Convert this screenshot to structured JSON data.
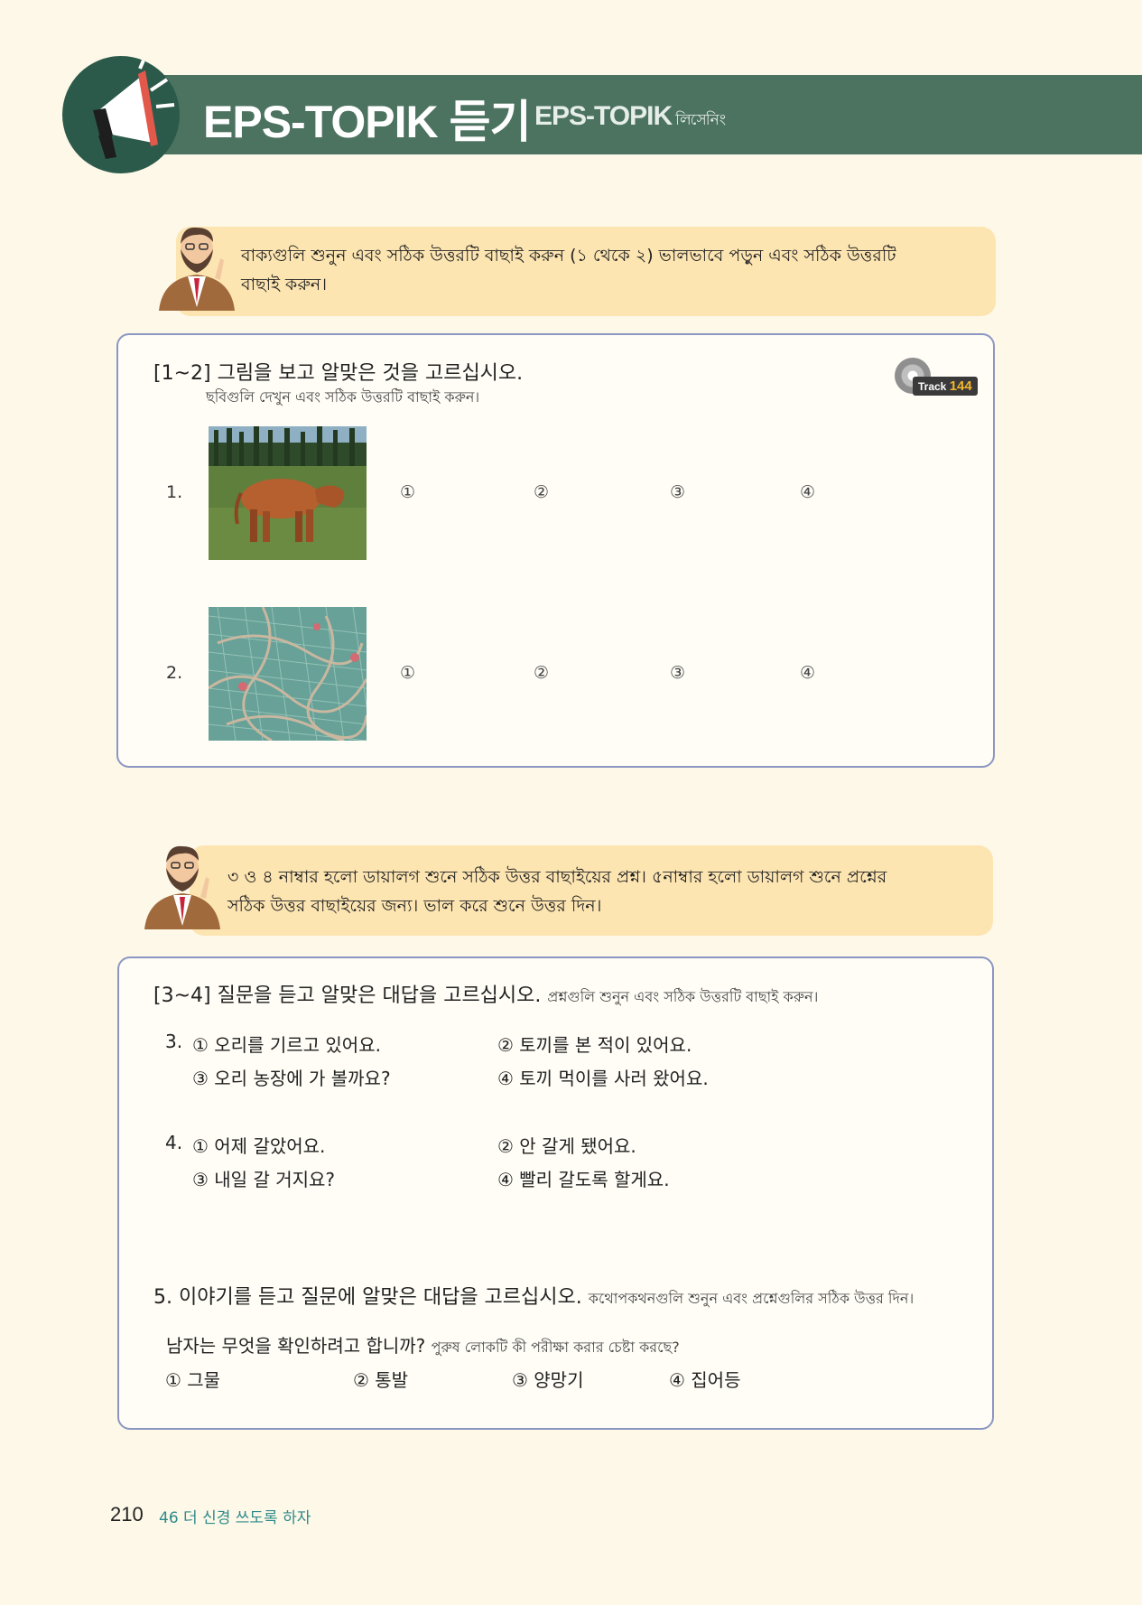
{
  "header": {
    "title": "EPS-TOPIK 듣기",
    "subtitle": "EPS-TOPIK",
    "subtitle_small": "লিসেনিং"
  },
  "instruction_1": {
    "line1": "বাক্যগুলি শুনুন এবং সঠিক উত্তরটি বাছাই করুন (১ থেকে ২) ভালভাবে পড়ুন এবং সঠিক উত্তরটি",
    "line2": "বাছাই করুন।"
  },
  "section_1": {
    "heading": "[1~2] 그림을 보고 알맞은 것을 고르십시오.",
    "translation": "ছবিগুলি দেখুন এবং সঠিক উত্তরটি বাছাই করুন।",
    "track_label": "Track",
    "track_number": "144",
    "questions": [
      {
        "number": "1.",
        "image": "brown cow in pasture",
        "choices": [
          "①",
          "②",
          "③",
          "④"
        ]
      },
      {
        "number": "2.",
        "image": "pile of fishing net",
        "choices": [
          "①",
          "②",
          "③",
          "④"
        ]
      }
    ]
  },
  "instruction_2": {
    "line1": "৩ ও ৪ নাম্বার হলো ডায়ালগ শুনে সঠিক উত্তর বাছাইয়ের প্রশ্ন। ৫নাম্বার হলো ডায়ালগ শুনে প্রশ্নের",
    "line2": "সঠিক উত্তর বাছাইয়ের জন্য। ভাল করে শুনে উত্তর দিন।"
  },
  "section_2": {
    "heading": "[3~4] 질문을 듣고 알맞은 대답을 고르십시오.",
    "translation": "প্রশ্নগুলি শুনুন এবং সঠিক উত্তরটি বাছাই করুন।",
    "q3": {
      "number": "3.",
      "options": [
        "① 오리를 기르고 있어요.",
        "② 토끼를 본 적이 있어요.",
        "③ 오리 농장에 가 볼까요?",
        "④ 토끼 먹이를 사러 왔어요."
      ]
    },
    "q4": {
      "number": "4.",
      "options": [
        "① 어제 갈았어요.",
        "② 안 갈게 됐어요.",
        "③ 내일 갈 거지요?",
        "④ 빨리 갈도록 할게요."
      ]
    },
    "q5": {
      "heading": "5. 이야기를 듣고 질문에 알맞은 대답을 고르십시오.",
      "translation": "কথোপকথনগুলি শুনুন এবং প্রশ্নেগুলির সঠিক উত্তর দিন।",
      "question": "남자는 무엇을 확인하려고 합니까?",
      "question_translation": "পুরুষ লোকটি কী পরীক্ষা করার চেষ্টা করছে?",
      "options": [
        "① 그물",
        "② 통발",
        "③ 양망기",
        "④ 집어등"
      ]
    }
  },
  "footer": {
    "page_number": "210",
    "lesson_title": "46 더 신경 쓰도록 하자"
  },
  "colors": {
    "banner": "#4c7260",
    "bubble": "#fde5b2",
    "box_border": "#8b97c2",
    "page_bg": "#fdf8e8",
    "track_accent": "#f2b42c",
    "lesson_title": "#2f8a8a"
  }
}
